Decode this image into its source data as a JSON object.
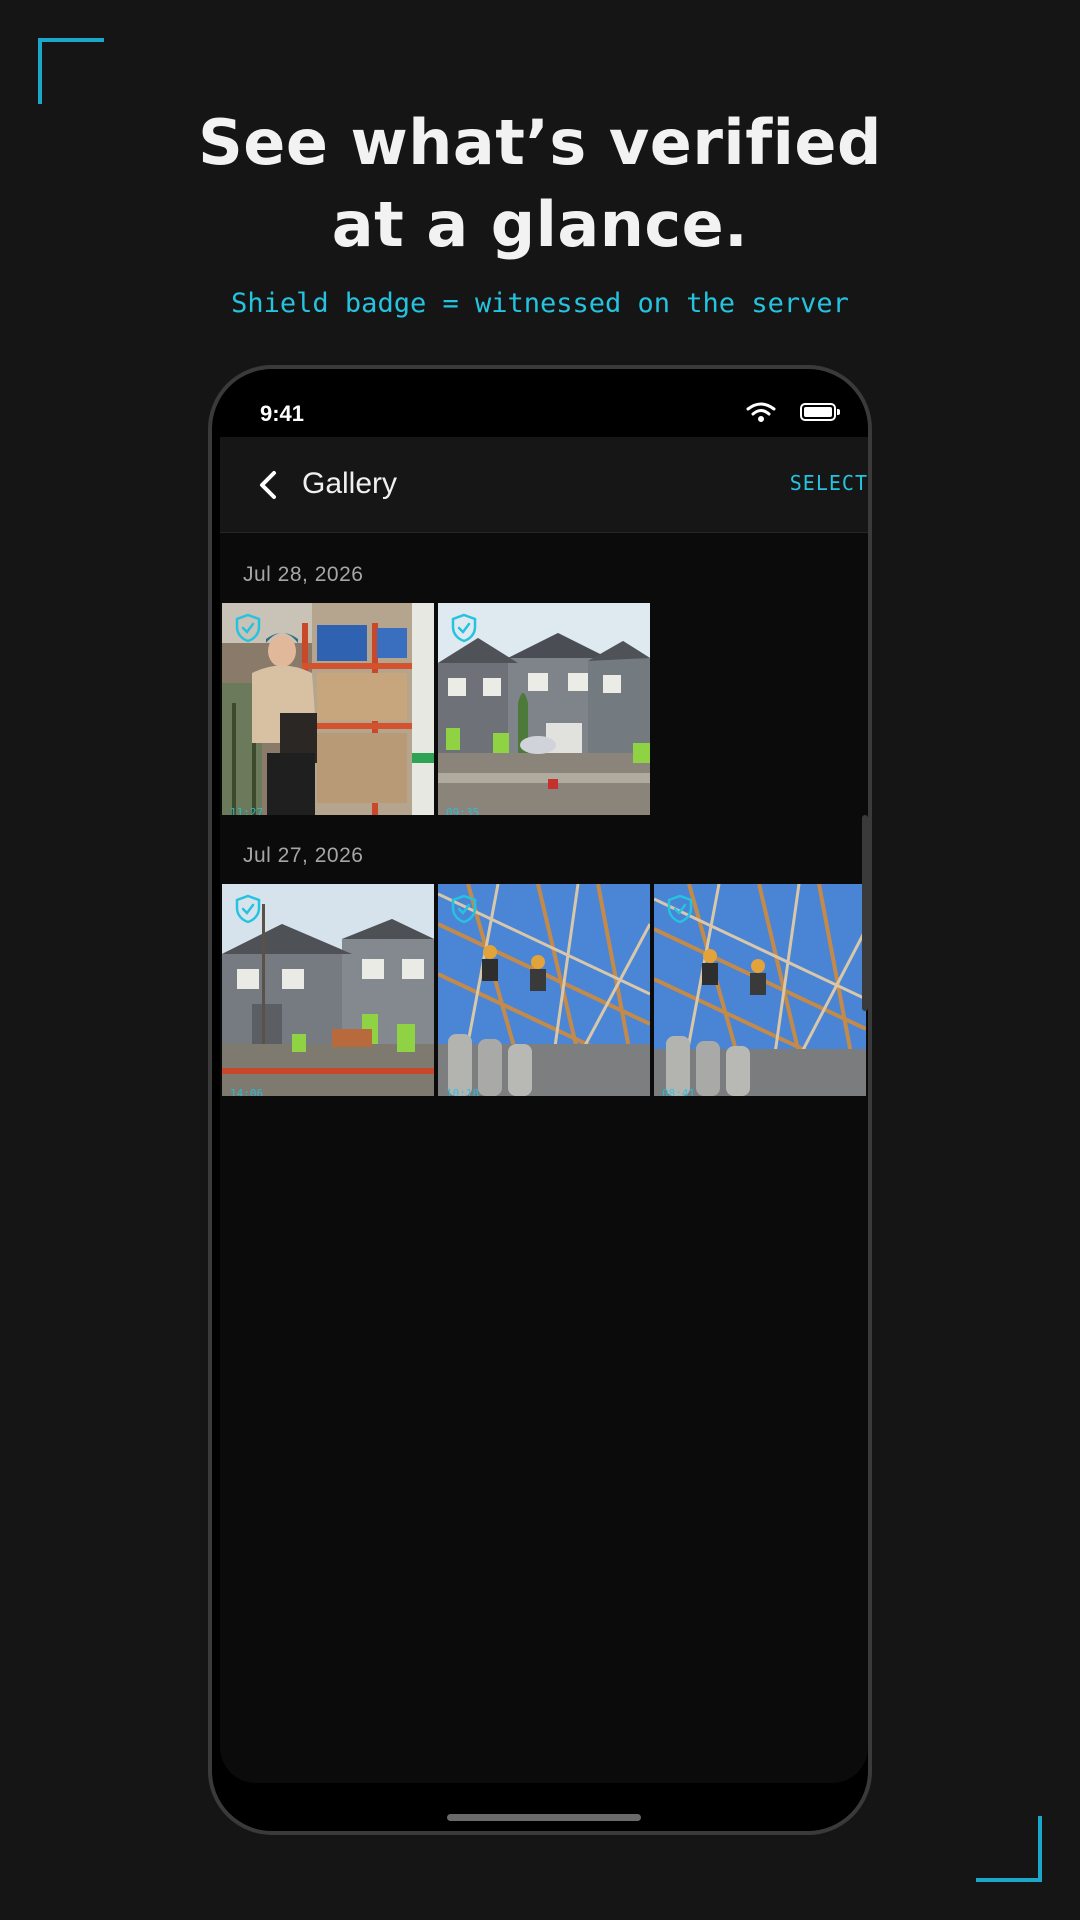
{
  "headline": {
    "line1": "See what’s verified",
    "line2": "at a glance."
  },
  "subline": "Shield badge = witnessed on the server",
  "accent_color": "#25c3e0",
  "status_bar": {
    "time": "9:41",
    "icons": [
      "wifi-icon",
      "battery-icon"
    ]
  },
  "app_bar": {
    "back_icon": "chevron-left-icon",
    "title": "Gallery",
    "select_label": "SELECT"
  },
  "groups": [
    {
      "date": "Jul 28, 2026",
      "items": [
        {
          "scene": "warehouse",
          "verified": true,
          "time": "11:27"
        },
        {
          "scene": "houses",
          "verified": true,
          "time": "09:35"
        }
      ]
    },
    {
      "date": "Jul 27, 2026",
      "items": [
        {
          "scene": "houses-close",
          "verified": true,
          "time": "14:06"
        },
        {
          "scene": "scaffold",
          "verified": true,
          "time": "10:18"
        },
        {
          "scene": "scaffold",
          "verified": true,
          "time": "08:41"
        }
      ]
    }
  ]
}
